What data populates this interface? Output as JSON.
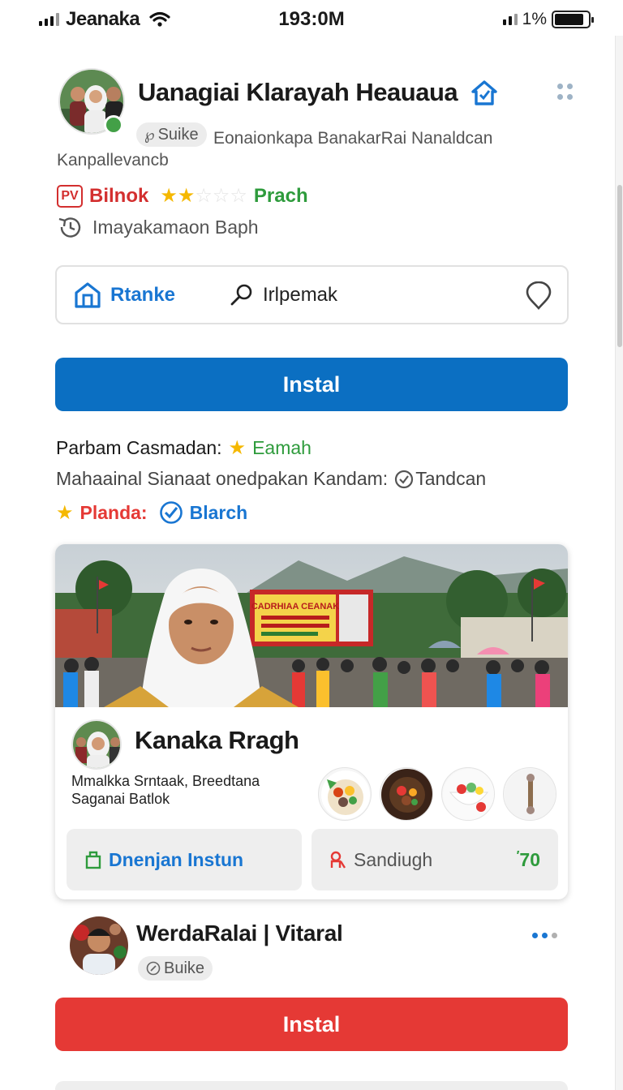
{
  "status_bar": {
    "carrier": "Jeanaka",
    "time": "193:0M",
    "battery_pct": "1%"
  },
  "profile": {
    "name": "Uanagiai Klarayah Heauaua",
    "tag": "Suike",
    "subtitle_right": "Eonaionkapa BanakarRai Nanaldcan",
    "subtitle_left": "Kanpallevancb",
    "rating_badge": "PV",
    "rating_label": "Bilnok",
    "stars_filled": 2,
    "stars_total": 5,
    "rating_status": "Prach",
    "info": "Imayakamaon Baph"
  },
  "action_row": {
    "left_label": "Rtanke",
    "search_label": "Irlpemak"
  },
  "install_primary": "Instal",
  "details": {
    "line1_label": "Parbam Casmadan:",
    "line1_value": "Eamah",
    "line2_label": "Mahaainal Sianaat onedpakan Kandam:",
    "line2_value": "Tandcan",
    "line3_label": "Planda:",
    "line3_value": "Blarch"
  },
  "card": {
    "banner_text": "CADRHIAA CEANAK",
    "name": "Kanaka Rragh",
    "desc_line1": "Mmalkka Srntaak, Breedtana",
    "desc_line2": "Saganai Batlok",
    "btn_left": "Dnenjan Instun",
    "btn_right": "Sandiugh",
    "btn_right_extra": "70"
  },
  "profile2": {
    "name": "WerdaRalai | Vitaral",
    "tag": "Buike"
  },
  "install_secondary": "Instal",
  "colors": {
    "primary_blue": "#0b6fc2",
    "danger_red": "#e53935",
    "success_green": "#2e9b3c",
    "star_gold": "#f5b800"
  }
}
